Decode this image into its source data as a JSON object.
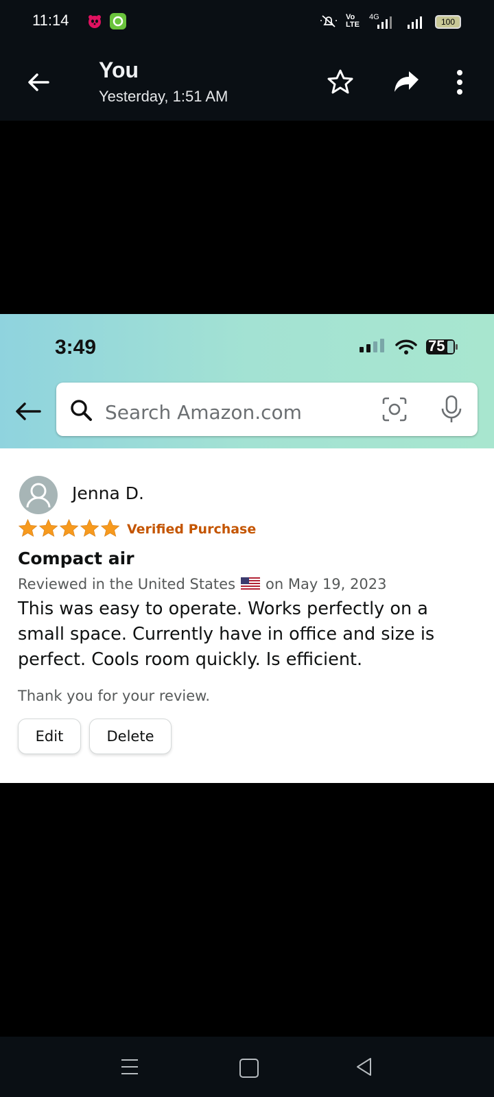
{
  "status_bar": {
    "time": "11:14",
    "battery": "100",
    "network": "4G",
    "volte": "Vo LTE"
  },
  "viewer": {
    "title": "You",
    "subtitle": "Yesterday, 1:51 AM",
    "icons": [
      "back-arrow-icon",
      "star-icon",
      "share-icon",
      "more-vert-icon"
    ]
  },
  "screenshot": {
    "ios_time": "3:49",
    "ios_battery": "75",
    "search": {
      "placeholder": "Search Amazon.com"
    },
    "review": {
      "reviewer": "Jenna D.",
      "rating": 5,
      "rating_max": 5,
      "verified": "Verified Purchase",
      "title": "Compact air",
      "meta_prefix": "Reviewed in the United States",
      "meta_suffix": "on May 19, 2023",
      "body": "This was easy to operate. Works perfectly on a small space. Currently have in office and size is perfect. Cools room quickly. Is efficient.",
      "thanks": "Thank you for your review.",
      "edit_label": "Edit",
      "delete_label": "Delete"
    },
    "colors": {
      "star": "#f79a1e",
      "verified": "#c45500",
      "header_gradient_start": "#8fd3de",
      "header_gradient_end": "#a8e6cf"
    }
  }
}
